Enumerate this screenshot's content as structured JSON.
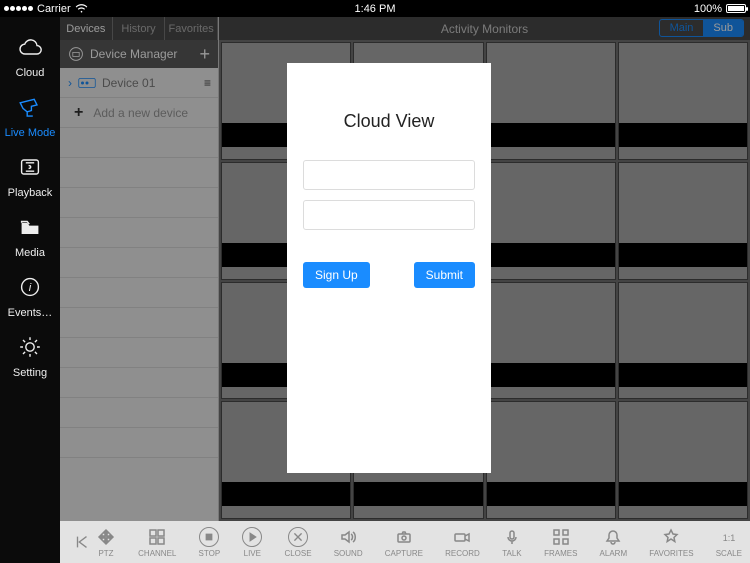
{
  "status": {
    "carrier": "Carrier",
    "time": "1:46 PM",
    "battery": "100%"
  },
  "rail": {
    "items": [
      {
        "key": "cloud",
        "label": "Cloud"
      },
      {
        "key": "live",
        "label": "Live Mode"
      },
      {
        "key": "playback",
        "label": "Playback"
      },
      {
        "key": "media",
        "label": "Media"
      },
      {
        "key": "events",
        "label": "Events…"
      },
      {
        "key": "setting",
        "label": "Setting"
      }
    ]
  },
  "panel": {
    "tabs": [
      "Devices",
      "History",
      "Favorites"
    ],
    "selectedTab": 0,
    "manager_label": "Device Manager",
    "device_label": "Device 01",
    "add_label": "Add a new device"
  },
  "topbar": {
    "title": "Activity Monitors",
    "seg": [
      "Main",
      "Sub"
    ],
    "selected": 1
  },
  "layout": {
    "grid_cols": 4,
    "grid_rows": 4
  },
  "bottombar": {
    "tools": [
      "PTZ",
      "CHANNEL",
      "STOP",
      "LIVE",
      "CLOSE",
      "SOUND",
      "CAPTURE",
      "RECORD",
      "TALK",
      "FRAMES",
      "ALARM",
      "FAVORITES",
      "SCALE"
    ]
  },
  "modal": {
    "title": "Cloud View",
    "username_placeholder": "",
    "password_placeholder": "",
    "signup": "Sign Up",
    "submit": "Submit"
  }
}
